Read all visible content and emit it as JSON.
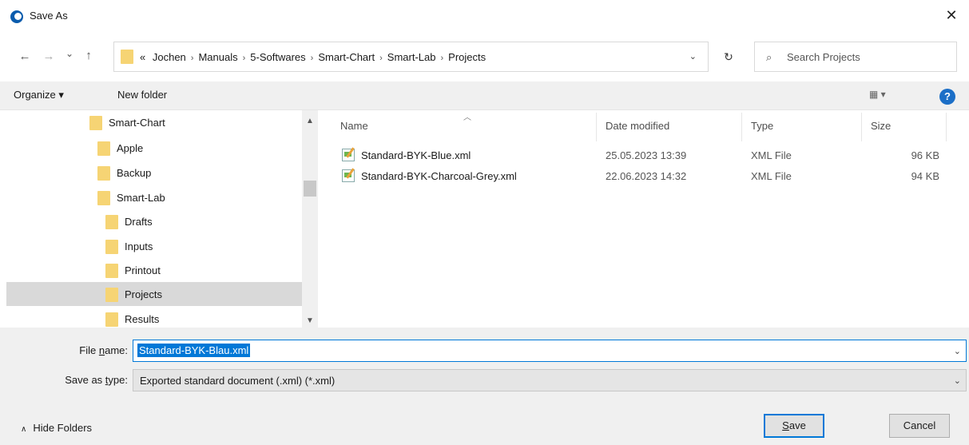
{
  "window": {
    "title": "Save As",
    "close_glyph": "✕"
  },
  "nav": {
    "back_glyph": "←",
    "forward_glyph": "→",
    "recent_glyph": "⌄",
    "up_glyph": "↑",
    "breadcrumb_prefix": "«",
    "breadcrumbs": [
      "Jochen",
      "Manuals",
      "5-Softwares",
      "Smart-Chart",
      "Smart-Lab",
      "Projects"
    ],
    "refresh_glyph": "↻",
    "search_placeholder": "Search Projects"
  },
  "toolbar": {
    "organize_label": "Organize ▾",
    "new_folder_label": "New folder",
    "view_glyph": "▦ ▾",
    "help_glyph": "?"
  },
  "tree": {
    "items": [
      {
        "label": "Smart-Chart",
        "selected": false
      },
      {
        "label": "Apple",
        "selected": false
      },
      {
        "label": "Backup",
        "selected": false
      },
      {
        "label": "Smart-Lab",
        "selected": false
      },
      {
        "label": "Drafts",
        "selected": false
      },
      {
        "label": "Inputs",
        "selected": false
      },
      {
        "label": "Printout",
        "selected": false
      },
      {
        "label": "Projects",
        "selected": true
      },
      {
        "label": "Results",
        "selected": false
      }
    ]
  },
  "filelist": {
    "columns": {
      "name": "Name",
      "date": "Date modified",
      "type": "Type",
      "size": "Size"
    },
    "sort_glyph": "︿",
    "files": [
      {
        "name": "Standard-BYK-Blue.xml",
        "date": "25.05.2023 13:39",
        "type": "XML File",
        "size": "96 KB"
      },
      {
        "name": "Standard-BYK-Charcoal-Grey.xml",
        "date": "22.06.2023 14:32",
        "type": "XML File",
        "size": "94 KB"
      }
    ]
  },
  "footer": {
    "file_name_label_pre": "File ",
    "file_name_label_u": "n",
    "file_name_label_post": "ame:",
    "file_name_value": "Standard-BYK-Blau.xml",
    "save_type_label_pre": "Save as ",
    "save_type_label_u": "t",
    "save_type_label_post": "ype:",
    "save_type_value": "Exported standard document (.xml) (*.xml)",
    "dropdown_glyph": "⌄",
    "hide_folders_glyph": "∧",
    "hide_folders_label": "Hide Folders",
    "save_u": "S",
    "save_rest": "ave",
    "cancel_label": "Cancel"
  }
}
